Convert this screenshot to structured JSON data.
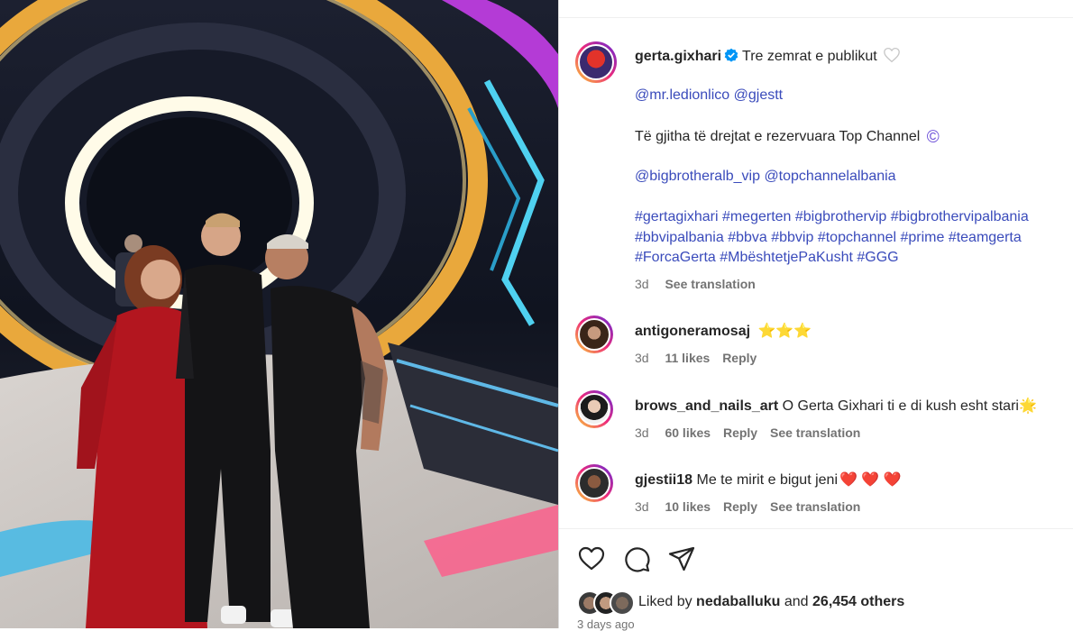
{
  "post": {
    "author": "gerta.gixhari",
    "caption": "Tre zemrat e publikut",
    "mentions_1": "@mr.ledionlico @gjestt",
    "rights": "Të gjitha të drejtat e rezervuara Top Channel",
    "copyright_symbol": "©",
    "mentions_2": "@bigbrotheralb_vip @topchannelalbania",
    "hashtags_line1": "#gertagixhari #megerten #bigbrothervip #bigbrothervipalbania",
    "hashtags_line2": "#bbvipalbania #bbva #bbvip #topchannel #prime #teamgerta",
    "hashtags_line3": "#ForcaGerta #MbështetjePaKusht #GGG",
    "time": "3d",
    "see_translation": "See translation"
  },
  "comments": [
    {
      "user": "antigoneramosaj",
      "text": "⭐⭐⭐",
      "time": "3d",
      "likes": "11 likes",
      "reply": "Reply"
    },
    {
      "user": "brows_and_nails_art",
      "text": "O Gerta Gixhari ti e di kush esht stari",
      "emoji": "🌟",
      "time": "3d",
      "likes": "60 likes",
      "reply": "Reply",
      "translate": "See translation"
    },
    {
      "user": "gjestii18",
      "text": "Me te mirit e bigut jeni",
      "emoji": "❤️ ❤️ ❤️",
      "time": "3d",
      "likes": "10 likes",
      "reply": "Reply",
      "translate": "See translation"
    }
  ],
  "likes": {
    "prefix": "Liked by",
    "user": "nedaballuku",
    "and": "and",
    "count": "26,454 others"
  },
  "date": "3 days ago",
  "icons": [
    "verified-badge-icon",
    "heart-icon",
    "comment-icon",
    "share-icon"
  ],
  "colors": {
    "link": "#3a4bbb",
    "verified": "#0095f6",
    "gradient": [
      "#f9ce34",
      "#ee2a7b",
      "#6228d7"
    ]
  }
}
